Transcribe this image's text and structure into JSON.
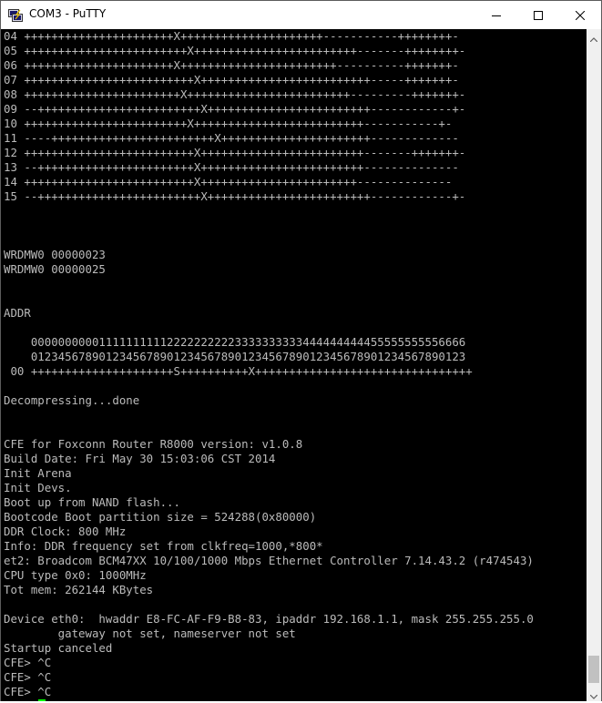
{
  "window": {
    "title": "COM3 - PuTTY"
  },
  "icons": {
    "app": "putty-icon",
    "minimize": "minimize-icon",
    "maximize": "maximize-icon",
    "close": "close-icon",
    "scroll_up": "scroll-up-icon",
    "scroll_down": "scroll-down-icon"
  },
  "colors": {
    "terminal_bg": "#000000",
    "terminal_fg": "#bbbbbb",
    "cursor": "#00ff00"
  },
  "terminal": {
    "lines": [
      "04 ++++++++++++++++++++++X+++++++++++++++++++++-----------++++++++-",
      "05 ++++++++++++++++++++++++X++++++++++++++++++++++++-------++++++++-",
      "06 ++++++++++++++++++++++X+++++++++++++++++++++++----------+++++++-",
      "07 +++++++++++++++++++++++++X+++++++++++++++++++++++++-----+++++++-",
      "08 +++++++++++++++++++++++X++++++++++++++++++++++++---------+++++++-",
      "09 --++++++++++++++++++++++++X++++++++++++++++++++++++------------+-",
      "10 ++++++++++++++++++++++++X+++++++++++++++++++++++++-----------+-",
      "11 ----++++++++++++++++++++++++X++++++++++++++++++++++-------------",
      "12 +++++++++++++++++++++++++X++++++++++++++++++++++++-------+++++++-",
      "13 --+++++++++++++++++++++++X++++++++++++++++++++++++--------------",
      "14 +++++++++++++++++++++++++X+++++++++++++++++++++++--------------",
      "15 --++++++++++++++++++++++++X++++++++++++++++++++++++------------+-",
      "",
      "",
      "",
      "WRDMW0 00000023",
      "WRDMW0 00000025",
      "",
      "",
      "ADDR",
      "",
      "    0000000000111111111122222222223333333333444444444455555555556666",
      "    0123456789012345678901234567890123456789012345678901234567890123",
      " 00 +++++++++++++++++++++S++++++++++X++++++++++++++++++++++++++++++++",
      "",
      "Decompressing...done",
      "",
      "",
      "CFE for Foxconn Router R8000 version: v1.0.8",
      "Build Date: Fri May 30 15:03:06 CST 2014",
      "Init Arena",
      "Init Devs.",
      "Boot up from NAND flash...",
      "Bootcode Boot partition size = 524288(0x80000)",
      "DDR Clock: 800 MHz",
      "Info: DDR frequency set from clkfreq=1000,*800*",
      "et2: Broadcom BCM47XX 10/100/1000 Mbps Ethernet Controller 7.14.43.2 (r474543)",
      "CPU type 0x0: 1000MHz",
      "Tot mem: 262144 KBytes",
      "",
      "Device eth0:  hwaddr E8-FC-AF-F9-B8-83, ipaddr 192.168.1.1, mask 255.255.255.0",
      "        gateway not set, nameserver not set",
      "Startup canceled",
      "CFE> ^C",
      "CFE> ^C",
      "CFE> ^C"
    ],
    "prompt": "CFE> "
  }
}
